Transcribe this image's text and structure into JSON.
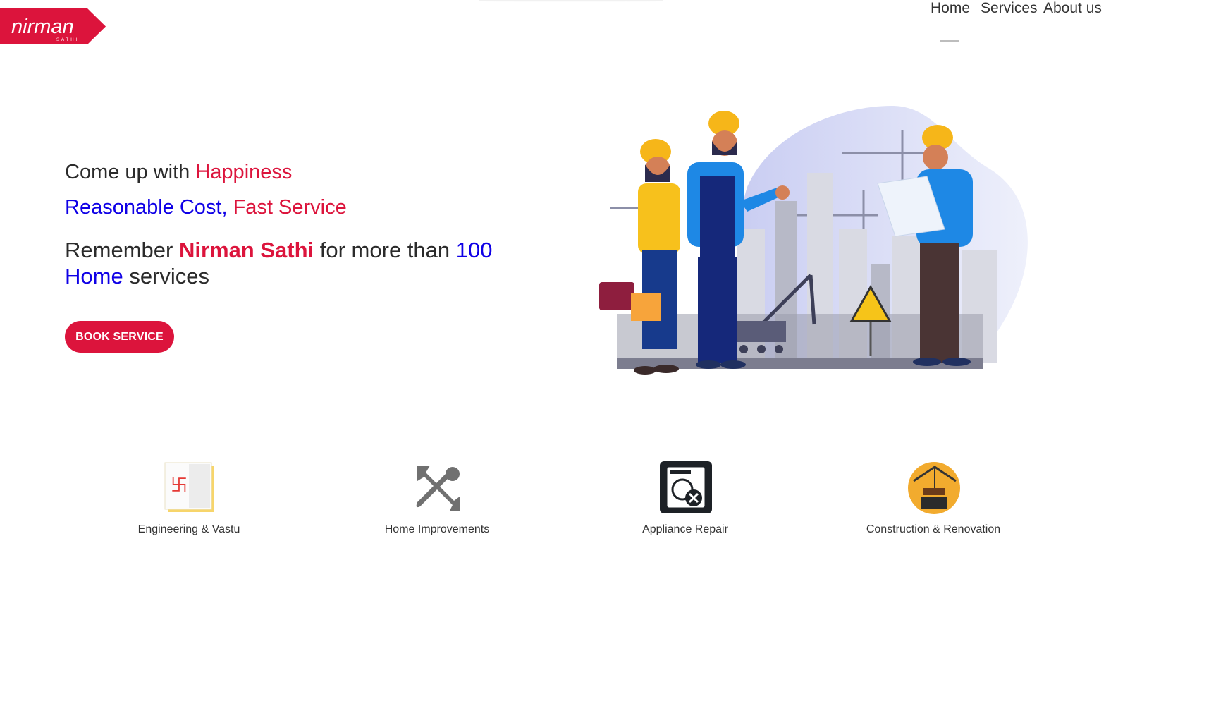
{
  "brand": {
    "logo_text": "nirman",
    "logo_subtext": "SATHI",
    "color": "#dc143c"
  },
  "nav": {
    "home": "Home",
    "services": "Services",
    "about": "About us"
  },
  "hero": {
    "line1": {
      "a": "Come up with ",
      "b": "Happiness"
    },
    "line2": {
      "a": "Reasonable Cost,",
      "b": " Fast Service"
    },
    "line3": {
      "a": "Remember ",
      "b": "Nirman Sathi",
      "c": " for more than ",
      "d": "100",
      "e": "Home",
      "f": " services"
    },
    "button": "BOOK SERVICE"
  },
  "services": [
    {
      "label": "Engineering & Vastu",
      "icon": "vastu-book-icon"
    },
    {
      "label": "Home Improvements",
      "icon": "tools-icon"
    },
    {
      "label": "Appliance Repair",
      "icon": "washing-machine-repair-icon"
    },
    {
      "label": "Construction & Renovation",
      "icon": "construction-crane-icon"
    }
  ],
  "colors": {
    "accent_red": "#dc143c",
    "accent_blue": "#0f00e6",
    "text": "#2b2b2b"
  }
}
